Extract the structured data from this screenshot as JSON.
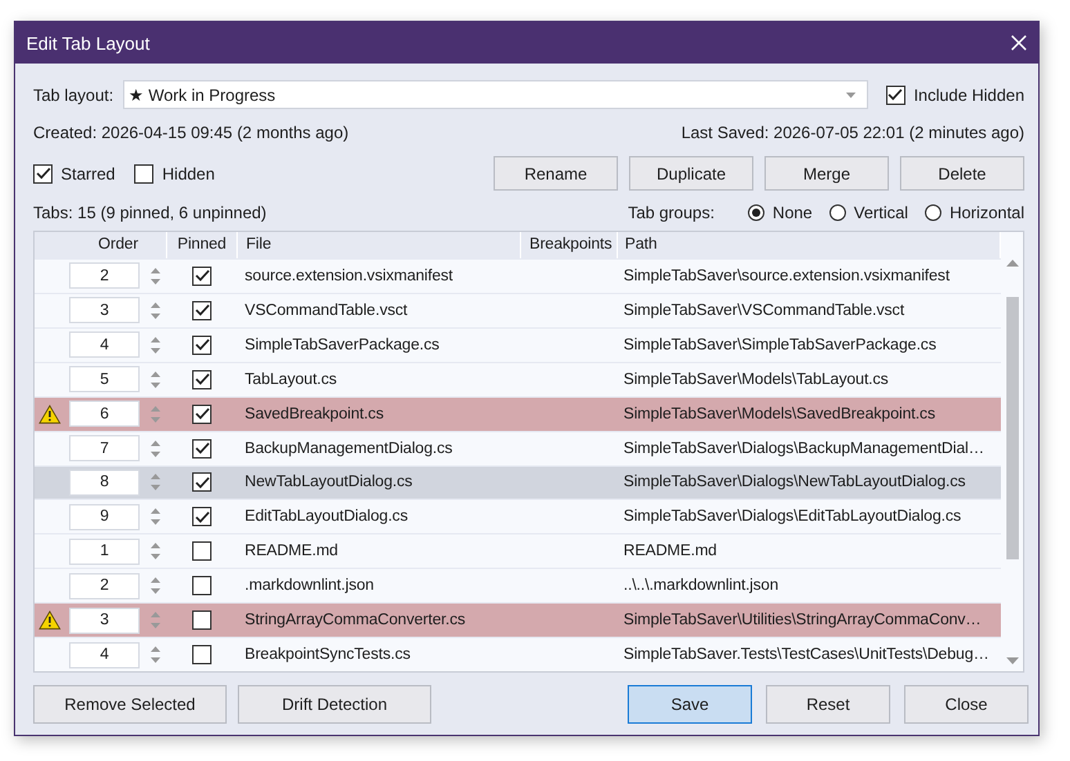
{
  "window": {
    "title": "Edit Tab Layout"
  },
  "tab_layout": {
    "label": "Tab layout:",
    "value": "★ Work in Progress"
  },
  "include_hidden": {
    "label": "Include Hidden",
    "checked": true
  },
  "created": "Created: 2026-04-15 09:45 (2 months ago)",
  "last_saved": "Last Saved: 2026-07-05 22:01 (2 minutes ago)",
  "flags": [
    {
      "label": "Starred",
      "checked": true
    },
    {
      "label": "Hidden",
      "checked": false
    }
  ],
  "actions": [
    "Rename",
    "Duplicate",
    "Merge",
    "Delete"
  ],
  "tabs_summary": "Tabs: 15 (9 pinned, 6 unpinned)",
  "tab_groups": {
    "label": "Tab groups:",
    "options": [
      {
        "label": "None",
        "selected": true
      },
      {
        "label": "Vertical",
        "selected": false
      },
      {
        "label": "Horizontal",
        "selected": false
      }
    ]
  },
  "table": {
    "columns": [
      "Order",
      "Pinned",
      "File",
      "Breakpoints",
      "Path"
    ],
    "rows": [
      {
        "warning": false,
        "selected": false,
        "order": "2",
        "pinned": true,
        "file": "source.extension.vsixmanifest",
        "path": "SimpleTabSaver\\source.extension.vsixmanifest"
      },
      {
        "warning": false,
        "selected": false,
        "order": "3",
        "pinned": true,
        "file": "VSCommandTable.vsct",
        "path": "SimpleTabSaver\\VSCommandTable.vsct"
      },
      {
        "warning": false,
        "selected": false,
        "order": "4",
        "pinned": true,
        "file": "SimpleTabSaverPackage.cs",
        "path": "SimpleTabSaver\\SimpleTabSaverPackage.cs"
      },
      {
        "warning": false,
        "selected": false,
        "order": "5",
        "pinned": true,
        "file": "TabLayout.cs",
        "path": "SimpleTabSaver\\Models\\TabLayout.cs"
      },
      {
        "warning": true,
        "selected": false,
        "order": "6",
        "pinned": true,
        "file": "SavedBreakpoint.cs",
        "path": "SimpleTabSaver\\Models\\SavedBreakpoint.cs"
      },
      {
        "warning": false,
        "selected": false,
        "order": "7",
        "pinned": true,
        "file": "BackupManagementDialog.cs",
        "path": "SimpleTabSaver\\Dialogs\\BackupManagementDial…"
      },
      {
        "warning": false,
        "selected": true,
        "order": "8",
        "pinned": true,
        "file": "NewTabLayoutDialog.cs",
        "path": "SimpleTabSaver\\Dialogs\\NewTabLayoutDialog.cs"
      },
      {
        "warning": false,
        "selected": false,
        "order": "9",
        "pinned": true,
        "file": "EditTabLayoutDialog.cs",
        "path": "SimpleTabSaver\\Dialogs\\EditTabLayoutDialog.cs"
      },
      {
        "warning": false,
        "selected": false,
        "order": "1",
        "pinned": false,
        "file": "README.md",
        "path": "README.md"
      },
      {
        "warning": false,
        "selected": false,
        "order": "2",
        "pinned": false,
        "file": ".markdownlint.json",
        "path": "..\\..\\.markdownlint.json"
      },
      {
        "warning": true,
        "selected": false,
        "order": "3",
        "pinned": false,
        "file": "StringArrayCommaConverter.cs",
        "path": "SimpleTabSaver\\Utilities\\StringArrayCommaConv…"
      },
      {
        "warning": false,
        "selected": false,
        "order": "4",
        "pinned": false,
        "file": "BreakpointSyncTests.cs",
        "path": "SimpleTabSaver.Tests\\TestCases\\UnitTests\\Debug…"
      }
    ]
  },
  "left_buttons": [
    {
      "label": "Remove Selected",
      "default": false
    },
    {
      "label": "Drift Detection",
      "default": false
    }
  ],
  "right_buttons": [
    {
      "label": "Save",
      "default": true
    },
    {
      "label": "Reset",
      "default": false
    },
    {
      "label": "Close",
      "default": false
    }
  ]
}
